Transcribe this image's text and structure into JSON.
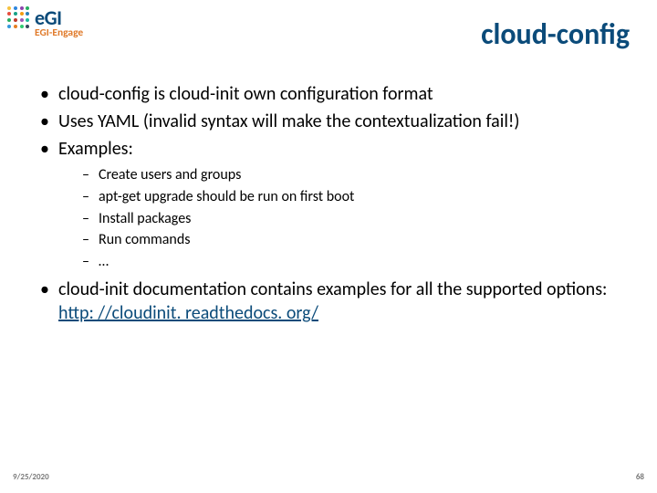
{
  "logo": {
    "brand_main": "eGI",
    "brand_sub": "EGI-Engage"
  },
  "title": "cloud-config",
  "bullets": {
    "b1": "cloud-config is cloud-init own configuration format",
    "b2": "Uses YAML (invalid syntax will make the contextualization fail!)",
    "b3": "Examples:",
    "sub": {
      "s1": "Create users and groups",
      "s2": "apt-get upgrade should be run on first boot",
      "s3": "Install packages",
      "s4": "Run commands",
      "s5": "…"
    },
    "b4_pre": "cloud-init documentation contains examples for all the supported options: ",
    "b4_link": "http: //cloudinit. readthedocs. org/"
  },
  "footer": {
    "date": "9/25/2020",
    "page": "68"
  },
  "colors": {
    "accent": "#0b4b7a",
    "engage": "#e07a2a"
  }
}
